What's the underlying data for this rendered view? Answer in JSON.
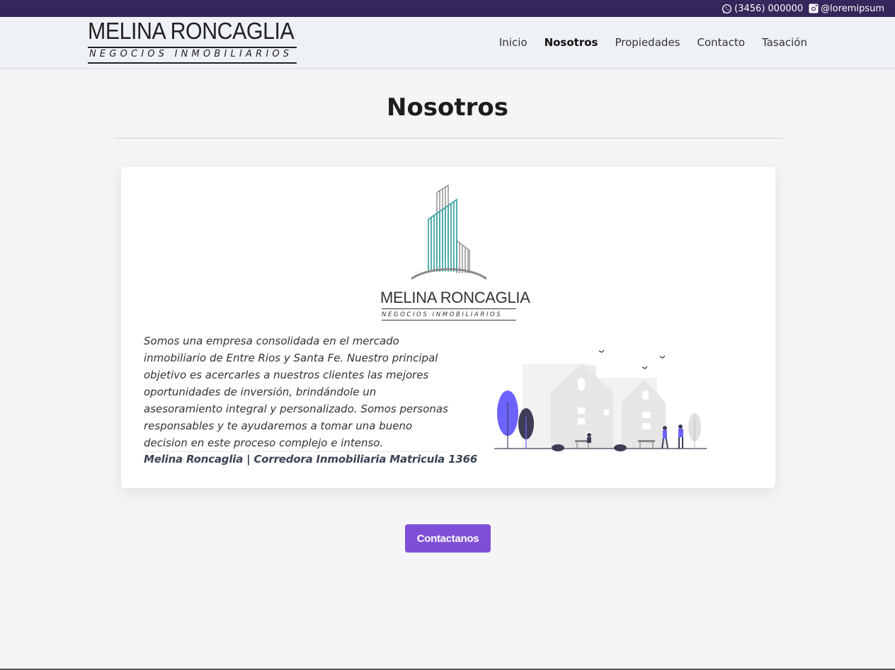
{
  "topbar": {
    "phone": "(3456) 000000",
    "instagram": "@loremipsum",
    "phone_icon": "whatsapp-icon",
    "instagram_icon": "instagram-icon"
  },
  "brand": {
    "name": "MELINA RONCAGLIA",
    "subtitle": "NEGOCIOS INMOBILIARIOS"
  },
  "nav": {
    "items": [
      {
        "label": "Inicio",
        "active": false
      },
      {
        "label": "Nosotros",
        "active": true
      },
      {
        "label": "Propiedades",
        "active": false
      },
      {
        "label": "Contacto",
        "active": false
      },
      {
        "label": "Tasación",
        "active": false
      }
    ]
  },
  "page": {
    "title": "Nosotros"
  },
  "card": {
    "logo_name": "MELINA RONCAGLIA",
    "logo_subtitle": "NEGOCIOS INMOBILIARIOS",
    "description": "Somos una empresa consolidada en el mercado inmobiliario de Entre Rios y Santa Fe. Nuestro principal objetivo es acercarles a nuestros clientes las mejores oportunidades de inversión, brindándole un asesoramiento integral y personalizado. Somos personas responsables y te ayudaremos a tomar una bueno decision en este proceso complejo e intenso.",
    "signature": "Melina Roncaglia | Corredora Inmobiliaria Matricula 1366"
  },
  "cta": {
    "label": "Contactanos"
  },
  "colors": {
    "topbar": "#35265b",
    "accent": "#7e4fd6",
    "teal": "#2a9d99",
    "illustration_purple": "#6c63ff"
  }
}
